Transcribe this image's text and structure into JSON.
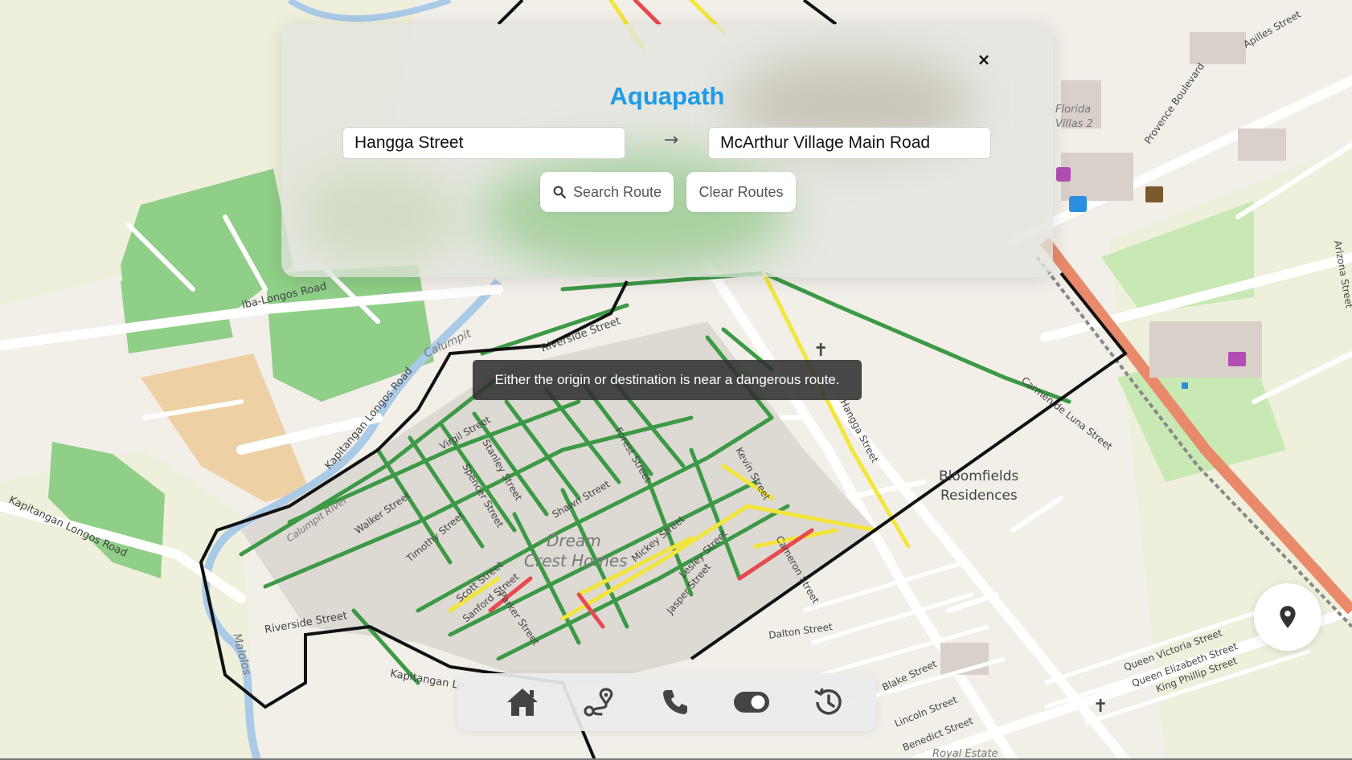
{
  "app": {
    "title": "Aquapath"
  },
  "search": {
    "origin_value": "Hangga Street",
    "destination_value": "McArthur Village Main Road",
    "arrow_symbol": "→",
    "search_label": "Search Route",
    "clear_label": "Clear Routes",
    "close_symbol": "×"
  },
  "toast": {
    "message": "Either the origin or destination is near a dangerous route."
  },
  "nav": {
    "items": [
      {
        "icon": "home-icon"
      },
      {
        "icon": "route-icon"
      },
      {
        "icon": "phone-icon"
      },
      {
        "icon": "toggle-icon"
      },
      {
        "icon": "history-icon"
      }
    ]
  },
  "map": {
    "labels": {
      "iba_longos": "Iba-Longos Road",
      "riverside_top": "Riverside Street",
      "riverside_bottom": "Riverside Street",
      "calumpit": "Calumpit",
      "kapitangan_longos_road": "Kapitangan Longos Road",
      "kapitangan_longos_road_left": "Kapitangan Longos Road",
      "kapitangan_lo": "Kapitangan Lo",
      "walker": "Walker Street",
      "virgil": "Virgil Street",
      "stanley": "Stanley Street",
      "spencer": "Spencer Street",
      "timothy": "Timothy Street",
      "shawn": "Shawn Street",
      "scott": "Scott Street",
      "sanford": "Sanford Street",
      "parker": "Parker Street",
      "forest": "Forest Street",
      "mickey": "Mickey Street",
      "lesley": "Lesley Street",
      "jasper": "Jasper Street",
      "kevin": "Kevin Street",
      "cameron": "Cameron Street",
      "hangga": "Hangga Street",
      "carmen": "Carmen de Luna Street",
      "dalton": "Dalton Street",
      "queen_victoria": "Queen Victoria Street",
      "queen_elizabeth": "Queen Elizabeth Street",
      "king_phillip": "King Phillip Street",
      "lincoln": "Lincoln Street",
      "benedict": "Benedict Street",
      "blake": "Blake Street",
      "provence": "Provence Boulevard",
      "apilles": "Apilles Street",
      "arizona": "Arizona Street",
      "florida_villas_1": "Florida",
      "florida_villas_2": "Villas 2",
      "dream_crest_1": "Dream",
      "dream_crest_2": "Crest Homes",
      "bloomfields_1": "Bloomfields",
      "bloomfields_2": "Residences",
      "royal_estate": "Royal Estate",
      "malolos": "Malolos",
      "river": "Calumpit River"
    }
  },
  "colors": {
    "accent": "#1e9be9",
    "safe_route": "#3c9a45",
    "moderate_route": "#f2e63a",
    "danger_route": "#e8494f",
    "boundary": "#111111",
    "river": "#a9cbe8",
    "park": "#8fcf87",
    "rail": "#e98a6a"
  }
}
